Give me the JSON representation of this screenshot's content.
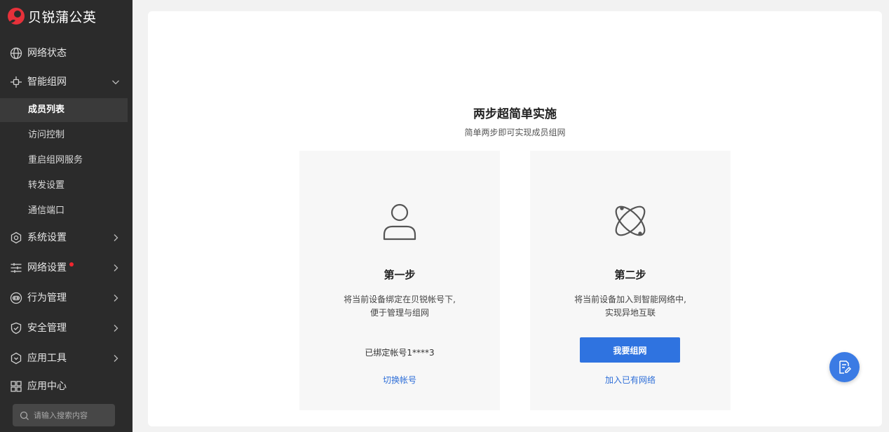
{
  "brand": {
    "name": "贝锐蒲公英",
    "color": "#e6313a"
  },
  "sidebar": {
    "items": [
      {
        "label": "网络状态",
        "icon": "globe-icon"
      },
      {
        "label": "智能组网",
        "icon": "network-icon",
        "expanded": true,
        "children": [
          {
            "label": "成员列表",
            "active": true
          },
          {
            "label": "访问控制"
          },
          {
            "label": "重启组网服务"
          },
          {
            "label": "转发设置"
          },
          {
            "label": "通信端口"
          }
        ]
      },
      {
        "label": "系统设置",
        "icon": "gear-icon"
      },
      {
        "label": "网络设置",
        "icon": "sliders-icon",
        "badge": true
      },
      {
        "label": "行为管理",
        "icon": "behavior-icon"
      },
      {
        "label": "安全管理",
        "icon": "shield-icon"
      },
      {
        "label": "应用工具",
        "icon": "tool-icon"
      },
      {
        "label": "应用中心",
        "icon": "apps-icon"
      }
    ],
    "search_placeholder": "请输入搜索内容"
  },
  "main": {
    "title": "两步超简单实施",
    "subtitle": "简单两步即可实现成员组网",
    "step1": {
      "icon": "user-icon",
      "title": "第一步",
      "desc_line1": "将当前设备绑定在贝锐帐号下,",
      "desc_line2": "便于管理与组网",
      "bound_account": "已绑定帐号1****3",
      "link": "切换帐号"
    },
    "step2": {
      "icon": "atom-icon",
      "title": "第二步",
      "desc_line1": "将当前设备加入到智能网络中,",
      "desc_line2": "实现异地互联",
      "button": "我要组网",
      "link": "加入已有网络"
    }
  },
  "fab": {
    "icon": "document-edit-icon"
  },
  "colors": {
    "primary": "#2f73e0",
    "link": "#2f6fd8",
    "sidebar_bg": "#2b2b2b"
  }
}
